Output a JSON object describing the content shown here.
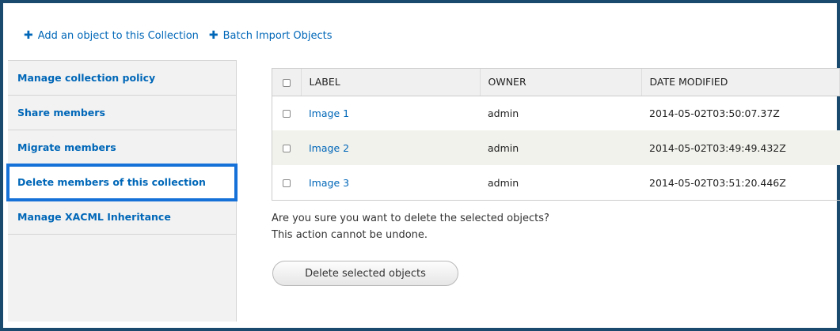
{
  "actions": {
    "add_object": "Add an object to this Collection",
    "batch_import": "Batch Import Objects"
  },
  "tabs": [
    {
      "label": "Manage collection policy"
    },
    {
      "label": "Share members"
    },
    {
      "label": "Migrate members"
    },
    {
      "label": "Delete members of this collection",
      "active": true
    },
    {
      "label": "Manage XACML Inheritance"
    }
  ],
  "table": {
    "headers": {
      "label": "LABEL",
      "owner": "OWNER",
      "date_modified": "DATE MODIFIED"
    },
    "rows": [
      {
        "label": "Image 1",
        "owner": "admin",
        "date_modified": "2014-05-02T03:50:07.37Z"
      },
      {
        "label": "Image 2",
        "owner": "admin",
        "date_modified": "2014-05-02T03:49:49.432Z"
      },
      {
        "label": "Image 3",
        "owner": "admin",
        "date_modified": "2014-05-02T03:51:20.446Z"
      }
    ]
  },
  "confirm": {
    "line1": "Are you sure you want to delete the selected objects?",
    "line2": "This action cannot be undone."
  },
  "delete_button": "Delete selected objects",
  "colors": {
    "link": "#0067b8",
    "highlight": "#1570d8",
    "frame": "#1a4a6e"
  }
}
